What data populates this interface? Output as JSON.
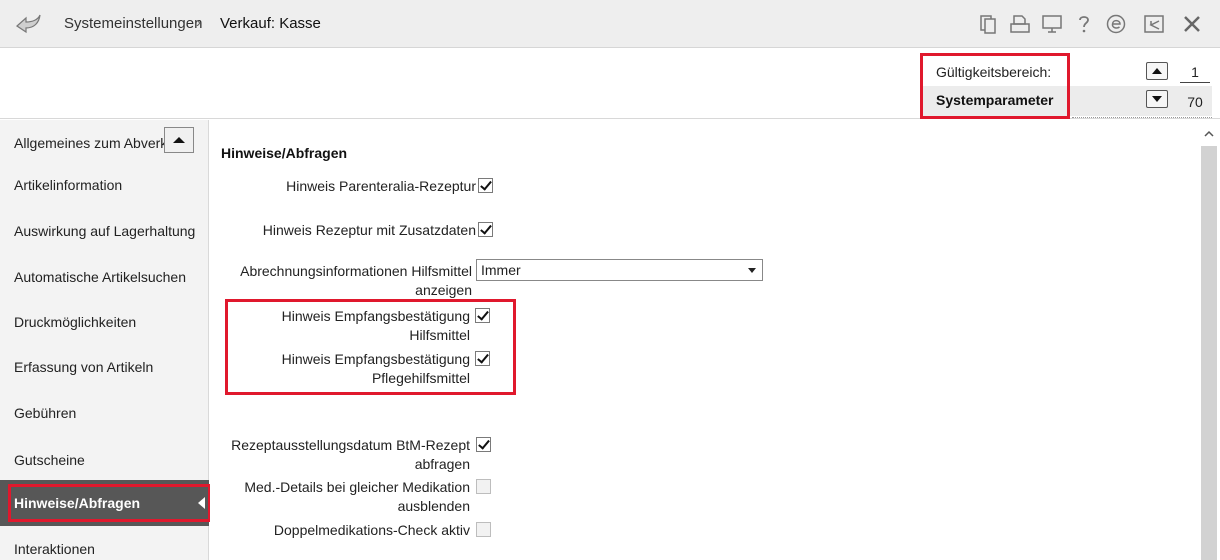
{
  "titlebar": {
    "breadcrumb_root": "Systemeinstellungen",
    "breadcrumb_separator": "›",
    "breadcrumb_current": "Verkauf: Kasse",
    "icons": [
      "back-icon",
      "copy-icon",
      "print-icon",
      "monitor-icon",
      "help-icon",
      "e-icon",
      "export-icon",
      "close-icon"
    ]
  },
  "scope": {
    "label": "Gültigkeitsbereich:",
    "value": "Systemparameter",
    "counter_top": "1",
    "counter_bottom": "70"
  },
  "sidebar": {
    "items": [
      {
        "label": "Allgemeines zum Abverkauf"
      },
      {
        "label": "Artikelinformation"
      },
      {
        "label": "Auswirkung auf Lagerhaltung"
      },
      {
        "label": "Automatische Artikelsuchen"
      },
      {
        "label": "Druckmöglichkeiten"
      },
      {
        "label": "Erfassung von Artikeln"
      },
      {
        "label": "Gebühren"
      },
      {
        "label": "Gutscheine"
      },
      {
        "label": "Hinweise/Abfragen"
      },
      {
        "label": "Interaktionen"
      }
    ],
    "active_index": 8
  },
  "main": {
    "section_title": "Hinweise/Abfragen",
    "options": [
      {
        "line1": "Hinweis Parenteralia-Rezeptur",
        "line2": "",
        "checked": true
      },
      {
        "line1": "Hinweis Rezeptur mit Zusatzdaten",
        "line2": "",
        "checked": true
      },
      {
        "line1": "Abrechnungsinformationen Hilfsmittel",
        "line2": "anzeigen",
        "type": "select",
        "value": "Immer"
      },
      {
        "line1": "Hinweis Empfangsbestätigung",
        "line2": "Hilfsmittel",
        "checked": true
      },
      {
        "line1": "Hinweis Empfangsbestätigung",
        "line2": "Pflegehilfsmittel",
        "checked": true
      },
      {
        "line1": "Rezeptausstellungsdatum BtM-Rezept",
        "line2": "abfragen",
        "checked": true
      },
      {
        "line1": "Med.-Details bei gleicher Medikation",
        "line2": "ausblenden",
        "checked": false
      },
      {
        "line1": "Doppelmedikations-Check aktiv",
        "line2": "",
        "checked": false
      }
    ]
  },
  "colors": {
    "highlight": "#e0182d",
    "active_item_bg": "#575757",
    "titlebar_bg": "#eeeeee"
  }
}
